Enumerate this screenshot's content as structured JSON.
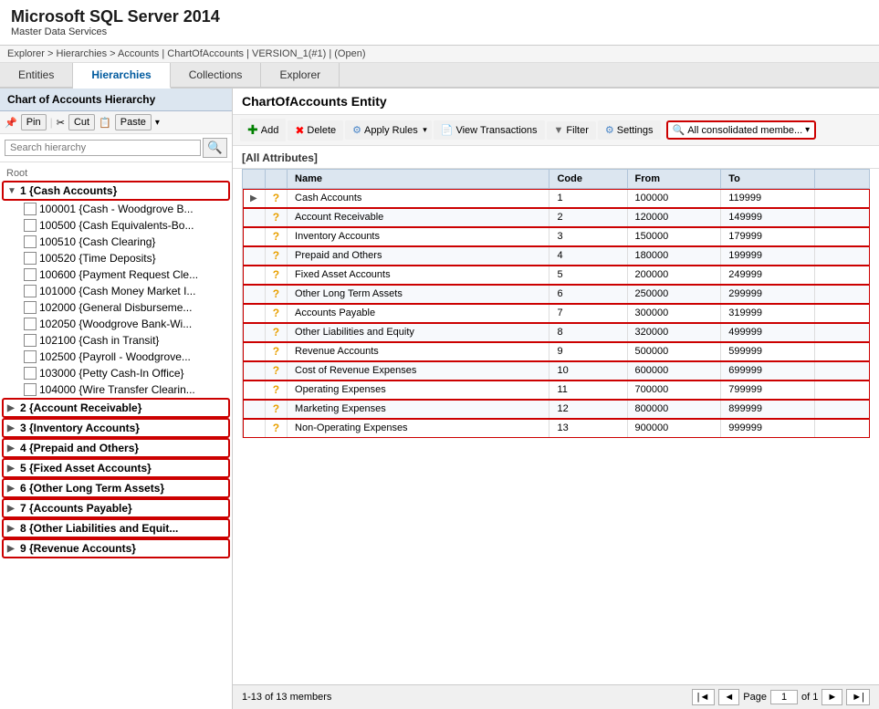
{
  "titleBar": {
    "appName": "Microsoft SQL Server 2014",
    "subtitle": "Master Data Services"
  },
  "breadcrumb": "Explorer > Hierarchies > Accounts | ChartOfAccounts | VERSION_1(#1) | (Open)",
  "topNav": {
    "tabs": [
      {
        "id": "entities",
        "label": "Entities"
      },
      {
        "id": "hierarchies",
        "label": "Hierarchies",
        "active": true
      },
      {
        "id": "collections",
        "label": "Collections"
      },
      {
        "id": "explorer",
        "label": "Explorer"
      }
    ]
  },
  "sidebar": {
    "title": "Chart of Accounts Hierarchy",
    "toolbar": {
      "pin_label": "Pin",
      "cut_label": "Cut",
      "paste_label": "Paste"
    },
    "search_placeholder": "Search hierarchy",
    "tree": {
      "root_label": "Root",
      "items": [
        {
          "id": "g1",
          "level": 1,
          "label": "1 {Cash Accounts}",
          "expanded": true,
          "highlighted": true
        },
        {
          "id": "i1",
          "level": 2,
          "label": "100001 {Cash - Woodgrove B..."
        },
        {
          "id": "i2",
          "level": 2,
          "label": "100500 {Cash Equivalents-Bo..."
        },
        {
          "id": "i3",
          "level": 2,
          "label": "100510 {Cash Clearing}"
        },
        {
          "id": "i4",
          "level": 2,
          "label": "100520 {Time Deposits}"
        },
        {
          "id": "i5",
          "level": 2,
          "label": "100600 {Payment Request Cle..."
        },
        {
          "id": "i6",
          "level": 2,
          "label": "101000 {Cash Money Market I..."
        },
        {
          "id": "i7",
          "level": 2,
          "label": "102000 {General Disburseme..."
        },
        {
          "id": "i8",
          "level": 2,
          "label": "102050 {Woodgrove Bank-Wi..."
        },
        {
          "id": "i9",
          "level": 2,
          "label": "102100 {Cash in Transit}"
        },
        {
          "id": "i10",
          "level": 2,
          "label": "102500 {Payroll - Woodgrove..."
        },
        {
          "id": "i11",
          "level": 2,
          "label": "103000 {Petty Cash-In Office}"
        },
        {
          "id": "i12",
          "level": 2,
          "label": "104000 {Wire Transfer Clearin..."
        },
        {
          "id": "g2",
          "level": 1,
          "label": "2 {Account Receivable}"
        },
        {
          "id": "g3",
          "level": 1,
          "label": "3 {Inventory Accounts}"
        },
        {
          "id": "g4",
          "level": 1,
          "label": "4 {Prepaid and Others}"
        },
        {
          "id": "g5",
          "level": 1,
          "label": "5 {Fixed Asset Accounts}"
        },
        {
          "id": "g6",
          "level": 1,
          "label": "6 {Other Long Term Assets}"
        },
        {
          "id": "g7",
          "level": 1,
          "label": "7 {Accounts Payable}"
        },
        {
          "id": "g8",
          "level": 1,
          "label": "8 {Other Liabilities and Equit..."
        },
        {
          "id": "g9",
          "level": 1,
          "label": "9 {Revenue Accounts}"
        }
      ]
    }
  },
  "rightPanel": {
    "entityTitle": "ChartOfAccounts Entity",
    "toolbar": {
      "add_label": "Add",
      "delete_label": "Delete",
      "apply_rules_label": "Apply Rules",
      "view_transactions_label": "View Transactions",
      "filter_label": "Filter",
      "settings_label": "Settings",
      "member_filter_label": "All consolidated membe..."
    },
    "sectionTitle": "[All Attributes]",
    "table": {
      "columns": [
        "",
        "",
        "Name",
        "Code",
        "From",
        "To",
        ""
      ],
      "rows": [
        {
          "expand": true,
          "icon": "?",
          "name": "Cash Accounts",
          "code": "1",
          "from": "100000",
          "to": "119999",
          "highlighted": true
        },
        {
          "expand": false,
          "icon": "?",
          "name": "Account Receivable",
          "code": "2",
          "from": "120000",
          "to": "149999",
          "highlighted": true
        },
        {
          "expand": false,
          "icon": "?",
          "name": "Inventory Accounts",
          "code": "3",
          "from": "150000",
          "to": "179999",
          "highlighted": true
        },
        {
          "expand": false,
          "icon": "?",
          "name": "Prepaid and Others",
          "code": "4",
          "from": "180000",
          "to": "199999",
          "highlighted": true
        },
        {
          "expand": false,
          "icon": "?",
          "name": "Fixed Asset Accounts",
          "code": "5",
          "from": "200000",
          "to": "249999",
          "highlighted": true
        },
        {
          "expand": false,
          "icon": "?",
          "name": "Other Long Term Assets",
          "code": "6",
          "from": "250000",
          "to": "299999",
          "highlighted": true
        },
        {
          "expand": false,
          "icon": "?",
          "name": "Accounts Payable",
          "code": "7",
          "from": "300000",
          "to": "319999",
          "highlighted": true
        },
        {
          "expand": false,
          "icon": "?",
          "name": "Other Liabilities and Equity",
          "code": "8",
          "from": "320000",
          "to": "499999",
          "highlighted": true
        },
        {
          "expand": false,
          "icon": "?",
          "name": "Revenue Accounts",
          "code": "9",
          "from": "500000",
          "to": "599999",
          "highlighted": true
        },
        {
          "expand": false,
          "icon": "?",
          "name": "Cost of Revenue Expenses",
          "code": "10",
          "from": "600000",
          "to": "699999",
          "highlighted": true
        },
        {
          "expand": false,
          "icon": "?",
          "name": "Operating Expenses",
          "code": "11",
          "from": "700000",
          "to": "799999",
          "highlighted": true
        },
        {
          "expand": false,
          "icon": "?",
          "name": "Marketing Expenses",
          "code": "12",
          "from": "800000",
          "to": "899999",
          "highlighted": true
        },
        {
          "expand": false,
          "icon": "?",
          "name": "Non-Operating Expenses",
          "code": "13",
          "from": "900000",
          "to": "999999",
          "highlighted": true
        }
      ]
    }
  },
  "bottomBar": {
    "record_count": "1-13 of 13 members",
    "page_label": "Page",
    "page_num": "1",
    "page_of": "of 1"
  }
}
